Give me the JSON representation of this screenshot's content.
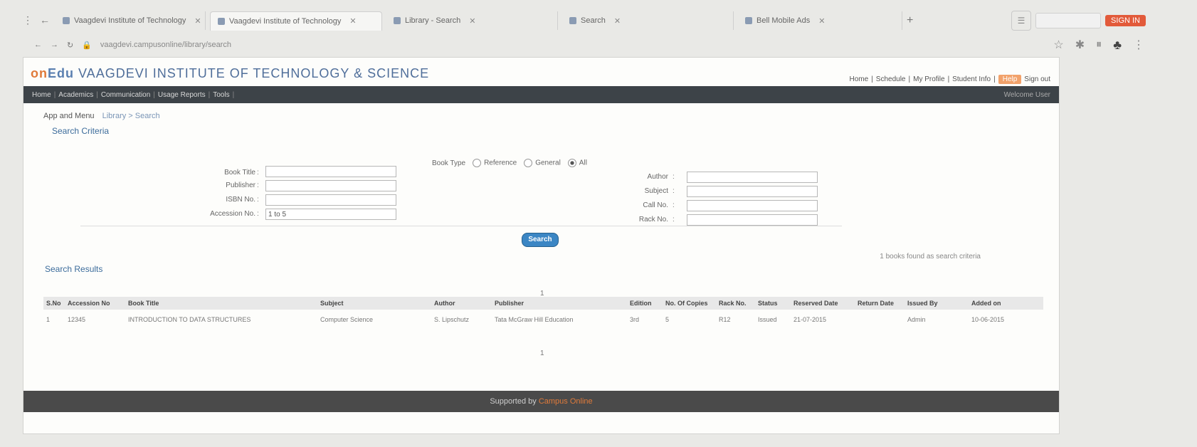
{
  "browser": {
    "tabs": [
      {
        "label": "Vaagdevi Institute of Technology",
        "active": false
      },
      {
        "label": "Vaagdevi Institute of Technology",
        "active": true
      },
      {
        "label": "Library - Search",
        "active": false
      },
      {
        "label": "Search",
        "active": false
      },
      {
        "label": "Bell Mobile Ads",
        "active": false
      }
    ],
    "url": "vaagdevi.campusonline/library/search",
    "top_badge": "SIGN IN"
  },
  "app": {
    "brand_prefix": "on",
    "brand_logo": "Edu",
    "brand_name": "VAAGDEVI INSTITUTE OF TECHNOLOGY & SCIENCE",
    "user_nav": [
      "Home",
      "Schedule",
      "My Profile",
      "Student Info",
      "Help",
      "Sign out"
    ],
    "user_nav_highlight": "Help",
    "nav_items": [
      "Home",
      "Academics",
      "Communication",
      "Usage Reports",
      "Tools"
    ],
    "nav_right": "Welcome User"
  },
  "breadcrumb": {
    "label": "App and Menu",
    "value": "Library > Search"
  },
  "search": {
    "title": "Search Criteria",
    "book_type_label": "Book Type",
    "radio_options": [
      "Reference",
      "General",
      "All"
    ],
    "radio_selected": "All",
    "left_fields": [
      {
        "label": "Book Title",
        "value": ""
      },
      {
        "label": "Publisher",
        "value": ""
      },
      {
        "label": "ISBN No.",
        "value": ""
      },
      {
        "label": "Accession No.",
        "value": "1 to 5"
      }
    ],
    "right_fields": [
      {
        "label": "Author",
        "value": ""
      },
      {
        "label": "Subject",
        "value": ""
      },
      {
        "label": "Call No.",
        "value": ""
      },
      {
        "label": "Rack No.",
        "value": ""
      }
    ],
    "button": "Search",
    "count_note": "1 books found as search criteria"
  },
  "results": {
    "title": "Search Results",
    "marker_top": "1",
    "marker_bottom": "1",
    "columns": [
      "S.No",
      "Accession No",
      "Book Title",
      "Subject",
      "Author",
      "Publisher",
      "Edition",
      "No. Of Copies",
      "Rack No.",
      "Status",
      "Reserved Date",
      "Return Date",
      "Issued By",
      "Added on"
    ],
    "rows": [
      [
        "1",
        "12345",
        "INTRODUCTION TO DATA STRUCTURES",
        "Computer Science",
        "S. Lipschutz",
        "Tata McGraw Hill Education",
        "3rd",
        "5",
        "R12",
        "Issued",
        "21-07-2015",
        "",
        "Admin",
        "10-06-2015"
      ]
    ]
  },
  "footer": {
    "text": "Supported by",
    "brand": "Campus Online"
  }
}
